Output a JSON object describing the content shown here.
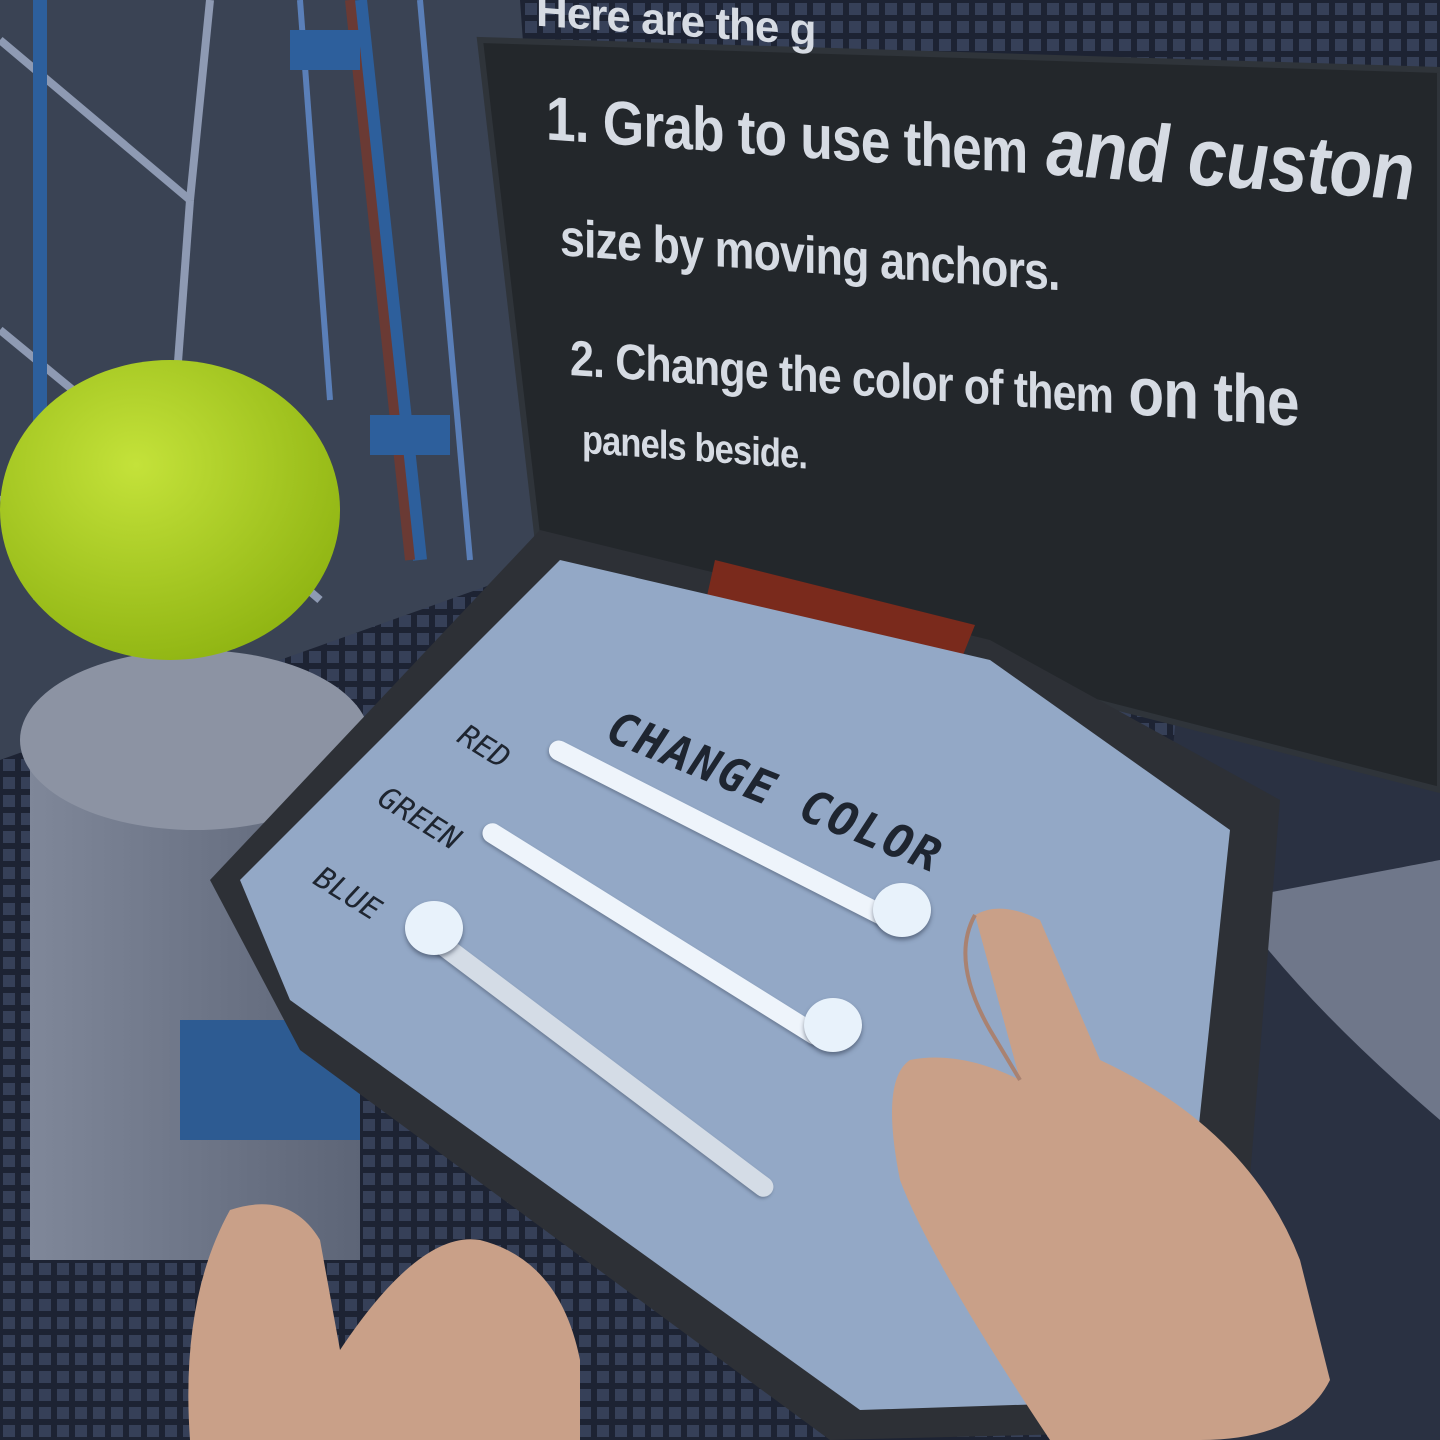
{
  "scene": {
    "type": "vr-tutorial-view",
    "colors": {
      "sign_background": "#23272b",
      "sign_text": "#d6dbe3",
      "panel_face": "#93a8c6",
      "panel_frame": "#2b2d33",
      "slider_track": "#eef4fb",
      "ball": "#a8cc1a",
      "hand_skin": "#c9a088",
      "handle": "#7a2a1c"
    }
  },
  "sign": {
    "line_0": "Here are the g",
    "line_1_part_a": "1. Grab to use them",
    "line_1_part_b": " and custon",
    "line_2": "size by moving anchors.",
    "line_3_part_a": "2. Change the color of them",
    "line_3_part_b": " on the",
    "line_4": "panels beside."
  },
  "panel": {
    "title": "CHANGE COLOR",
    "sliders": [
      {
        "label": "RED",
        "value": 1.0
      },
      {
        "label": "GREEN",
        "value": 1.0
      },
      {
        "label": "BLUE",
        "value": 0.0
      }
    ]
  },
  "icons": [
    "ball-object",
    "left-hand-icon",
    "right-hand-icon",
    "panel-handle"
  ]
}
